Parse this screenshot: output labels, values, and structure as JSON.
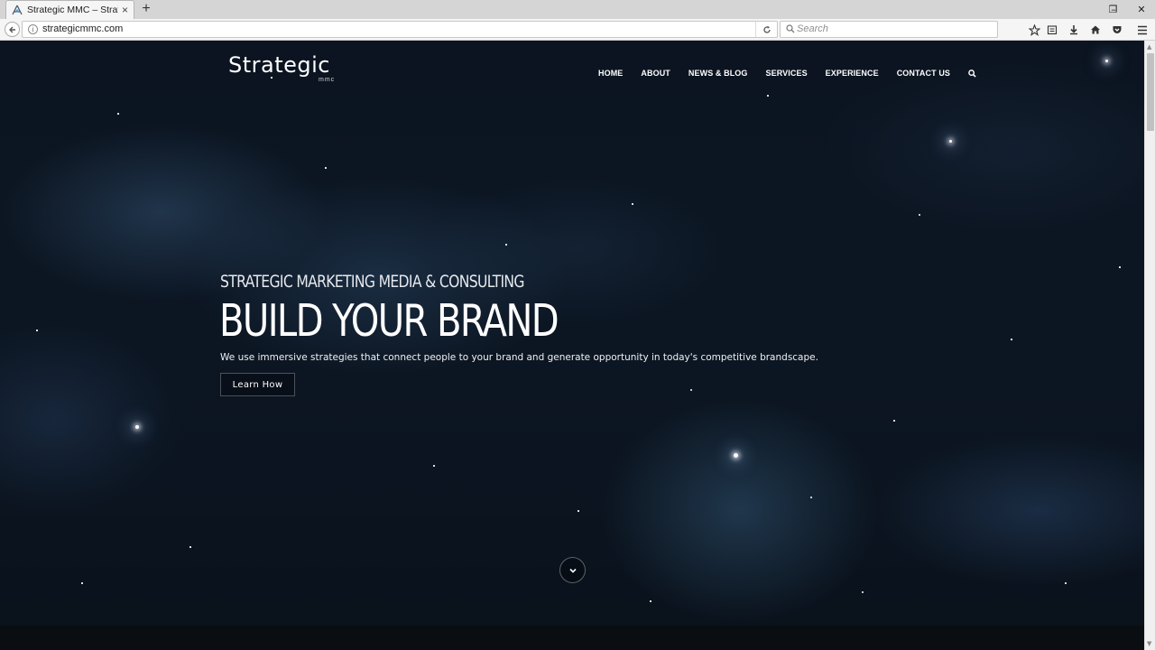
{
  "browser": {
    "tab_title": "Strategic MMC – Strategic…",
    "tab_close": "×",
    "new_tab": "+",
    "url": "strategicmmc.com",
    "search_placeholder": "Search",
    "window_controls": [
      "–",
      "❐",
      "✕"
    ]
  },
  "site": {
    "logo_text": "Strategic",
    "logo_sub": "mmc",
    "nav": [
      {
        "label": "HOME"
      },
      {
        "label": "ABOUT"
      },
      {
        "label": "NEWS & BLOG"
      },
      {
        "label": "SERVICES"
      },
      {
        "label": "EXPERIENCE"
      },
      {
        "label": "CONTACT US"
      }
    ]
  },
  "hero": {
    "kicker": "STRATEGIC MARKETING MEDIA & CONSULTING",
    "title": "BUILD YOUR BRAND",
    "description": "We use immersive strategies that connect people to your brand and generate opportunity in today's competitive brandscape.",
    "cta": "Learn How"
  },
  "icons": {
    "scroll_down": "chevron-down-icon",
    "nav_search": "search-icon"
  }
}
